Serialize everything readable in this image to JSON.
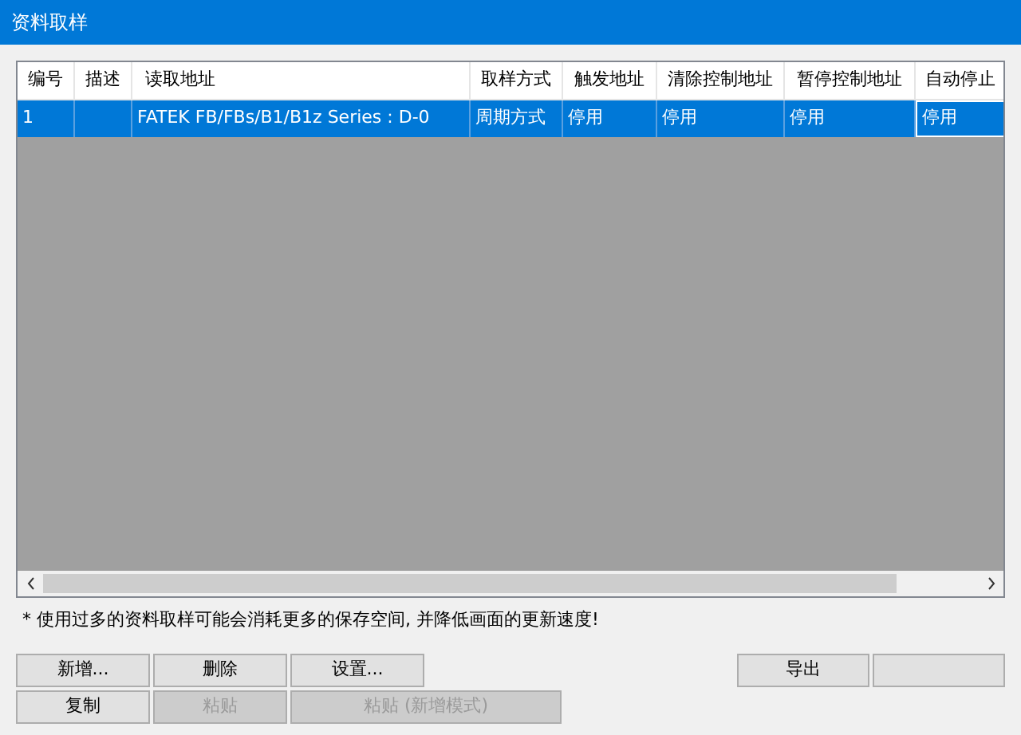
{
  "window": {
    "title": "资料取样"
  },
  "table": {
    "columns": [
      "编号",
      "描述",
      "读取地址",
      "取样方式",
      "触发地址",
      "清除控制地址",
      "暂停控制地址",
      "自动停止"
    ],
    "rows": [
      {
        "selected": true,
        "cells": [
          "1",
          "",
          "FATEK FB/FBs/B1/B1z Series : D-0",
          "周期方式",
          "停用",
          "停用",
          "停用",
          "停用"
        ]
      }
    ]
  },
  "note": "* 使用过多的资料取样可能会消耗更多的保存空间, 并降低画面的更新速度!",
  "buttons_row_1": [
    {
      "label": "新增...",
      "disabled": false
    },
    {
      "label": "删除",
      "disabled": false
    },
    {
      "label": "设置...",
      "disabled": false
    }
  ],
  "buttons_row_2": [
    {
      "label": "复制",
      "disabled": false
    },
    {
      "label": "粘贴",
      "disabled": true
    },
    {
      "label": "粘贴 (新增模式)",
      "disabled": true
    }
  ],
  "buttons_right": [
    {
      "label": "导出",
      "disabled": false
    },
    {
      "disabled": false
    }
  ]
}
